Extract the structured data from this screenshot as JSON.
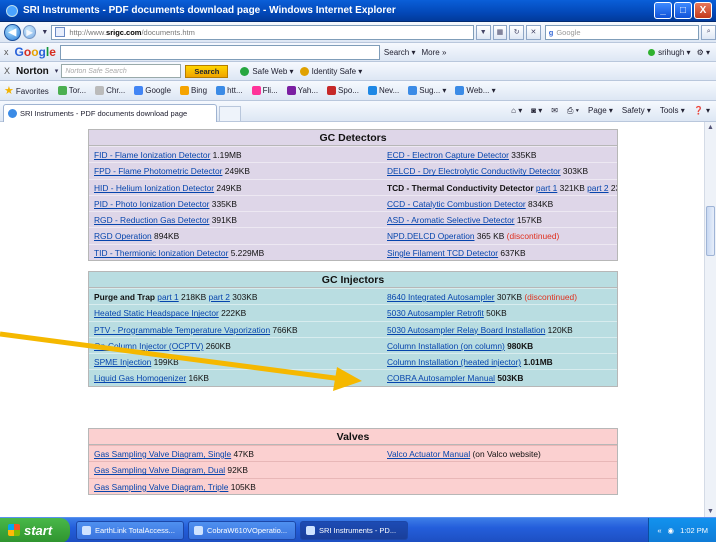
{
  "window": {
    "title": "SRI Instruments - PDF documents download page - Windows Internet Explorer",
    "minimize": "_",
    "maximize": "□",
    "close": "X"
  },
  "address": {
    "prefix": "http://www.",
    "domain": "srigc.com",
    "path": "/documents.htm",
    "search_placeholder": "Google"
  },
  "google_bar": {
    "close": "x",
    "search_label": "Search",
    "more_label": "More »",
    "user": "srihugh"
  },
  "norton_bar": {
    "close": "X",
    "logo": "Norton",
    "placeholder": "Norton Safe Search",
    "search_button": "Search",
    "safe_web": "Safe Web",
    "identity_safe": "Identity Safe"
  },
  "favorites_bar": {
    "favorites": "Favorites",
    "items": [
      "Tor...",
      "Chr...",
      "Google",
      "Bing",
      "htt...",
      "Fli...",
      "Yah...",
      "Spo...",
      "Nev...",
      "Sug...",
      "Web..."
    ]
  },
  "tab_bar": {
    "tab_title": "SRI Instruments - PDF documents download page",
    "page_menu": "Page",
    "safety_menu": "Safety",
    "tools_menu": "Tools"
  },
  "sections": {
    "detectors": {
      "title": "GC Detectors",
      "left": [
        {
          "link": "FID - Flame Ionization Detector",
          "size": " 1.19MB"
        },
        {
          "link": "FPD - Flame Photometric Detector",
          "size": " 249KB"
        },
        {
          "link": "HID - Helium Ionization Detector",
          "size": " 249KB"
        },
        {
          "link": "PID - Photo Ionization Detector",
          "size": " 335KB"
        },
        {
          "link": "RGD - Reduction Gas Detector",
          "size": " 391KB"
        },
        {
          "link": "RGD Operation",
          "size": " 894KB"
        },
        {
          "link": "TID - Thermionic Ionization Detector",
          "size": " 5.229MB"
        }
      ],
      "right": [
        {
          "link": "ECD - Electron Capture Detector",
          "size": " 335KB"
        },
        {
          "link": "DELCD - Dry Electrolytic Conductivity Detector",
          "size": " 303KB"
        },
        {
          "text": "TCD - Thermal Conductivity Detector ",
          "link": "part 1",
          "size": " 321KB ",
          "link2": "part 2",
          "size2": " 235KB"
        },
        {
          "link": "CCD - Catalytic Combustion Detector",
          "size": " 834KB"
        },
        {
          "link": "ASD - Aromatic Selective Detector",
          "size": " 157KB"
        },
        {
          "link": "NPD.DELCD Operation",
          "size": " 365 KB ",
          "note": "(discontinued)"
        },
        {
          "link": "Single Filament TCD Detector",
          "size": " 637KB"
        }
      ]
    },
    "injectors": {
      "title": "GC Injectors",
      "left": [
        {
          "text": "Purge and Trap ",
          "link": "part 1",
          "size": " 218KB ",
          "link2": "part 2",
          "size2": " 303KB"
        },
        {
          "link": "Heated Static Headspace Injector",
          "size": " 222KB"
        },
        {
          "link": "PTV - Programmable Temperature Vaporization",
          "size": " 766KB"
        },
        {
          "link": "On-Column Injector (OCPTV)",
          "size": " 260KB"
        },
        {
          "link": "SPME Injection",
          "size": " 199KB"
        },
        {
          "link": "Liquid Gas Homogenizer",
          "size": " 16KB"
        }
      ],
      "right": [
        {
          "link": "8640 Integrated Autosampler",
          "size": " 307KB ",
          "note": "(discontinued)"
        },
        {
          "link": "5030 Autosampler Retrofit",
          "size": " 50KB"
        },
        {
          "link": "5030 Autosampler Relay Board Installation",
          "size": " 120KB"
        },
        {
          "link": "Column Installation (on column)",
          "size": " 980KB"
        },
        {
          "link": "Column Installation (heated injector)",
          "size": " 1.01MB"
        },
        {
          "link": "COBRA Autosampler Manual",
          "size": " 503KB"
        }
      ]
    },
    "valves": {
      "title": "Valves",
      "left": [
        {
          "link": "Gas Sampling Valve Diagram, Single",
          "size": " 47KB"
        },
        {
          "link": "Gas Sampling Valve Diagram, Dual",
          "size": " 92KB"
        },
        {
          "link": "Gas Sampling Valve Diagram, Triple",
          "size": " 105KB"
        }
      ],
      "right": [
        {
          "link": "Valco Actuator Manual",
          "size": " (on Valco website)"
        },
        {
          "link": "",
          "size": ""
        },
        {
          "link": "",
          "size": ""
        }
      ]
    }
  },
  "taskbar": {
    "start": "start",
    "tasks": [
      "EarthLink TotalAccess...",
      "CobraW610VOperatio...",
      "SRI Instruments - PD..."
    ],
    "clock": "1:02 PM"
  },
  "colors": {
    "detectors_bg": "#ded6e8",
    "injectors_bg": "#b9dde1",
    "valves_bg": "#fbd0d0",
    "link": "#0645ad",
    "discontinued": "#e0301e",
    "arrow": "#f5b800"
  }
}
